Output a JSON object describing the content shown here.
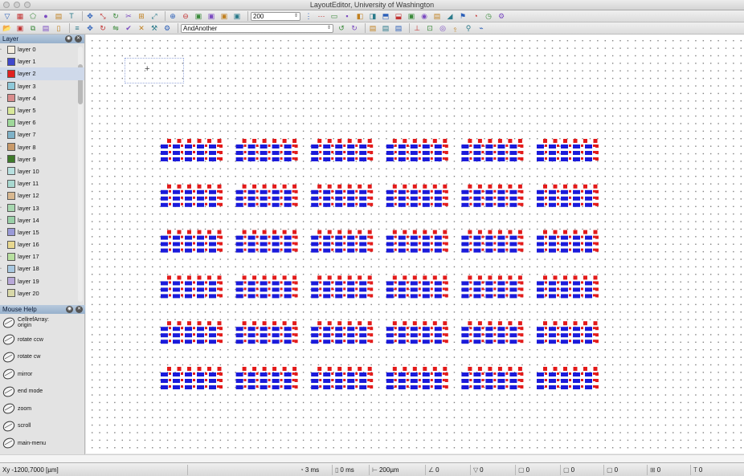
{
  "window": {
    "title": "LayoutEditor, University of Washington"
  },
  "toolbar1": {
    "icons": [
      "select-arrow-icon",
      "box-icon",
      "polygon-icon",
      "circle-icon",
      "path-icon",
      "text-T-icon",
      "move-icon",
      "scale-icon",
      "rotate-icon",
      "cut-icon",
      "merge-icon",
      "stretch-icon",
      "zoom-in-icon",
      "zoom-out-icon",
      "boolean-and-icon",
      "boolean-or-icon",
      "boolean-xor-icon",
      "boolean-sub-icon",
      "grid-icon",
      "array-icon",
      "ruler-icon",
      "snap-icon",
      "align-left-icon",
      "align-right-icon",
      "align-top-icon",
      "align-bottom-icon",
      "center-icon",
      "cellref-icon",
      "cell-icon",
      "triangle-icon",
      "flag-icon",
      "pie-icon",
      "clock-icon",
      "settings-icon"
    ],
    "grid_value": "200"
  },
  "toolbar2": {
    "icons": [
      "open-icon",
      "save-icon",
      "copy-icon",
      "paste-icon",
      "new-doc-icon",
      "layers-icon",
      "move-to-icon",
      "rotate-to-icon",
      "mirror-icon",
      "lock-icon",
      "delete-icon",
      "hierarchy-icon",
      "macro-icon"
    ],
    "cell_name": "AndAnother",
    "right_icons": [
      "undo-icon",
      "redo-icon",
      "doc-icon",
      "doc2-icon",
      "doc3-icon",
      "tree-icon",
      "plug-icon",
      "chip-icon",
      "probe-icon",
      "pin-icon",
      "wire-icon"
    ]
  },
  "layer_panel": {
    "title": "Layer",
    "layers": [
      {
        "name": "layer 0",
        "color": "#f2ece0"
      },
      {
        "name": "layer 1",
        "color": "#3f48cc"
      },
      {
        "name": "layer 2",
        "color": "#e02020"
      },
      {
        "name": "layer 3",
        "color": "#8fc9d9"
      },
      {
        "name": "layer 4",
        "color": "#d98c8c"
      },
      {
        "name": "layer 5",
        "color": "#d8e89a"
      },
      {
        "name": "layer 6",
        "color": "#9fd89a"
      },
      {
        "name": "layer 7",
        "color": "#7fb2c8"
      },
      {
        "name": "layer 8",
        "color": "#c89a6a"
      },
      {
        "name": "layer 9",
        "color": "#3e7a2a"
      },
      {
        "name": "layer 10",
        "color": "#b8e0e0"
      },
      {
        "name": "layer 11",
        "color": "#a8d8d0"
      },
      {
        "name": "layer 12",
        "color": "#d8b890"
      },
      {
        "name": "layer 13",
        "color": "#a8d8b0"
      },
      {
        "name": "layer 14",
        "color": "#9ad0a8"
      },
      {
        "name": "layer 15",
        "color": "#9a9ad8"
      },
      {
        "name": "layer 16",
        "color": "#e8d890"
      },
      {
        "name": "layer 17",
        "color": "#b8e0a0"
      },
      {
        "name": "layer 18",
        "color": "#a8c8e0"
      },
      {
        "name": "layer 19",
        "color": "#b8a8d8"
      },
      {
        "name": "layer 20",
        "color": "#d8d8a8"
      }
    ]
  },
  "mouse_help": {
    "title": "Mouse Help",
    "items": [
      {
        "label": "CellrefArray: origin"
      },
      {
        "label": "rotate ccw"
      },
      {
        "label": "rotate cw"
      },
      {
        "label": "mirror"
      },
      {
        "label": "end mode"
      },
      {
        "label": "zoom"
      },
      {
        "label": "scroll"
      },
      {
        "label": "main-menu"
      }
    ]
  },
  "layout_array": {
    "rows": 6,
    "cols": 6,
    "fill_blue": "#1a1adb",
    "fill_red": "#e31a1a"
  },
  "statusbar": {
    "coords": "-1200,7000 [µm]",
    "coords_prefix": "Xy",
    "time1": "3 ms",
    "time2": "0 ms",
    "grid": "200µm",
    "c1": "0",
    "c2": "0",
    "c3": "0",
    "c4": "0",
    "c5": "0",
    "c6": "0",
    "c7": "0"
  }
}
